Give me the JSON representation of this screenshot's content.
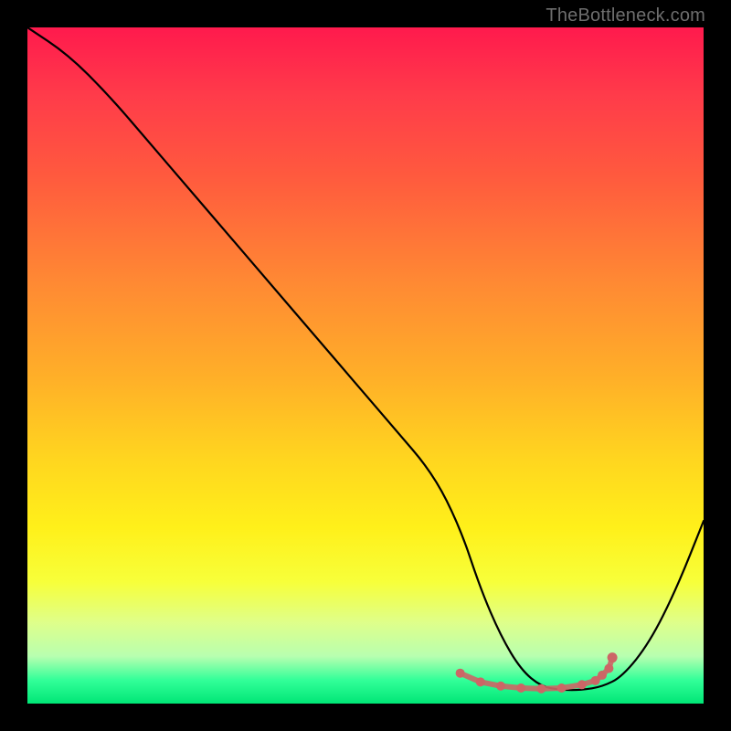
{
  "watermark": "TheBottleneck.com",
  "chart_data": {
    "type": "line",
    "title": "",
    "xlabel": "",
    "ylabel": "",
    "xlim": [
      0,
      100
    ],
    "ylim": [
      0,
      100
    ],
    "x": [
      0,
      6,
      12,
      18,
      24,
      30,
      36,
      42,
      48,
      54,
      60,
      64,
      67,
      70,
      73,
      76,
      79,
      82,
      85,
      88,
      92,
      96,
      100
    ],
    "values": [
      100,
      96,
      90,
      83,
      76,
      69,
      62,
      55,
      48,
      41,
      34,
      26,
      17,
      10,
      5,
      2.5,
      2,
      2,
      2.5,
      4,
      9,
      17,
      27
    ],
    "marker_region": {
      "x": [
        64,
        67,
        70,
        73,
        76,
        79,
        82,
        84,
        85,
        86,
        86.5
      ],
      "values": [
        4.5,
        3.2,
        2.6,
        2.3,
        2.2,
        2.3,
        2.8,
        3.4,
        4.2,
        5.2,
        6.8
      ]
    },
    "colors": {
      "curve": "#000000",
      "markers": "#cc6666",
      "gradient_top": "#ff1a4d",
      "gradient_bottom": "#00e676"
    }
  }
}
